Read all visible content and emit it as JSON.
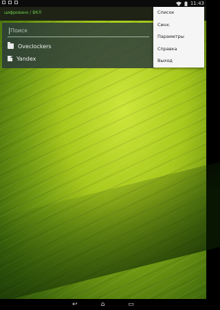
{
  "status_bar": {
    "time": "11:43",
    "left_icons": [
      "notification-icon",
      "image-icon",
      "bag-icon"
    ],
    "right_icons": [
      "wifi-icon",
      "battery-icon"
    ]
  },
  "action_bar": {
    "title": "цифровано /   ВКЛ"
  },
  "search": {
    "placeholder": "Поиск"
  },
  "items": [
    {
      "label": "Oveclockers",
      "icon": "folder-icon"
    },
    {
      "label": "Yandex",
      "icon": "document-icon"
    }
  ],
  "menu": {
    "items": [
      {
        "label": "Список"
      },
      {
        "label": "Синх."
      },
      {
        "label": "Параметры"
      },
      {
        "label": "Справка"
      },
      {
        "label": "Выход"
      }
    ]
  },
  "nav_bar": {
    "back_icon": "↩",
    "home_icon": "⌂",
    "recent_icon": "▭"
  },
  "colors": {
    "accent": "#6fd24a",
    "panel": "#28373a",
    "menu_bg": "#f5f5f5"
  }
}
